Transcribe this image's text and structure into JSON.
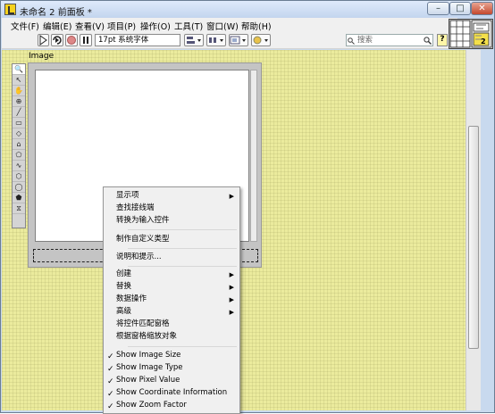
{
  "window": {
    "title": "未命名 2 前面板 *",
    "minimize": "–",
    "maximize": "□",
    "close": "✕"
  },
  "menu": [
    "文件(F)",
    "编辑(E)",
    "查看(V)",
    "项目(P)",
    "操作(O)",
    "工具(T)",
    "窗口(W)",
    "帮助(H)"
  ],
  "toolbar": {
    "font": "17pt 系统字体",
    "search_placeholder": "搜索",
    "help": "?"
  },
  "connector": {
    "number": "2"
  },
  "front_panel": {
    "control_label": "Image"
  },
  "context_menu": {
    "group1": [
      {
        "label": "显示项",
        "submenu": true
      },
      {
        "label": "查找接线端"
      },
      {
        "label": "转换为输入控件"
      }
    ],
    "group2": [
      {
        "label": "制作自定义类型"
      }
    ],
    "group3": [
      {
        "label": "说明和提示..."
      }
    ],
    "group4": [
      {
        "label": "创建",
        "submenu": true
      },
      {
        "label": "替换",
        "submenu": true
      },
      {
        "label": "数据操作",
        "submenu": true
      },
      {
        "label": "高级",
        "submenu": true
      },
      {
        "label": "将控件匹配窗格"
      },
      {
        "label": "根据窗格缩放对象"
      }
    ],
    "group5": [
      {
        "label": "Show Image Size",
        "checked": true
      },
      {
        "label": "Show Image Type",
        "checked": true
      },
      {
        "label": "Show Pixel Value",
        "checked": true
      },
      {
        "label": "Show Coordinate Information",
        "checked": true
      },
      {
        "label": "Show Zoom Factor",
        "checked": true
      }
    ]
  }
}
